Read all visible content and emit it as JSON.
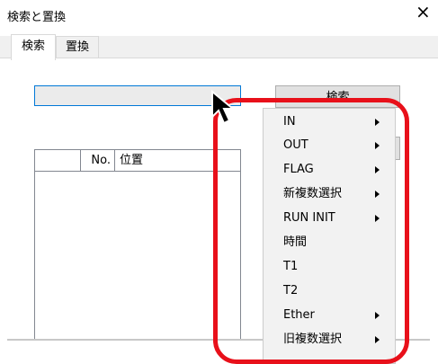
{
  "window": {
    "title": "検索と置換",
    "close_glyph": "×"
  },
  "tabs": [
    {
      "label": "検索",
      "active": true
    },
    {
      "label": "置換",
      "active": false
    }
  ],
  "search": {
    "value": "",
    "button_label": "検索"
  },
  "results_table": {
    "columns": [
      "",
      "No.",
      "位置"
    ],
    "rows": []
  },
  "context_menu": {
    "items": [
      {
        "label": "IN",
        "submenu": true
      },
      {
        "label": "OUT",
        "submenu": true
      },
      {
        "label": "FLAG",
        "submenu": true
      },
      {
        "label": "新複数選択",
        "submenu": true
      },
      {
        "label": "RUN INIT",
        "submenu": true
      },
      {
        "label": "時間",
        "submenu": false
      },
      {
        "label": "T1",
        "submenu": false
      },
      {
        "label": "T2",
        "submenu": false
      },
      {
        "label": "Ether",
        "submenu": true
      },
      {
        "label": "旧複数選択",
        "submenu": true
      }
    ]
  },
  "annotation": {
    "color": "#e8101a"
  }
}
